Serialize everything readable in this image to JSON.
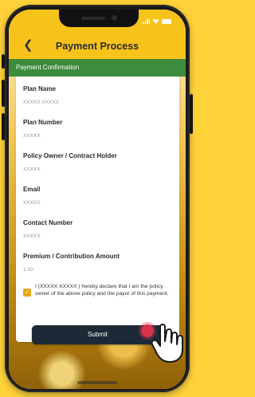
{
  "header": {
    "title": "Payment Process"
  },
  "section": {
    "title": "Payment Confirmation"
  },
  "fields": [
    {
      "label": "Plan Name",
      "value": "XXXXX XXXXX"
    },
    {
      "label": "Plan Number",
      "value": "XXXXX"
    },
    {
      "label": "Policy Owner / Contract Holder",
      "value": "XXXXX"
    },
    {
      "label": "Email",
      "value": "XXXXX"
    },
    {
      "label": "Contact Number",
      "value": "XXXXX"
    },
    {
      "label": "Premium / Contribution Amount",
      "value": "1.00"
    }
  ],
  "declaration": {
    "checked": true,
    "text": "I (XXXXX XXXXX ) hereby declare that I am the policy owner of the above policy and the payor of this payment."
  },
  "submit_label": "Submit",
  "colors": {
    "header_bg": "#f7c21a",
    "section_bar": "#3d8b3d",
    "button_bg": "#1c2a37",
    "checkbox": "#e8a41a",
    "tap_indicator": "#d8324e"
  },
  "icons": [
    "back-arrow-icon",
    "signal-icon",
    "wifi-icon",
    "battery-icon",
    "checkmark-icon",
    "tap-hand-icon"
  ]
}
